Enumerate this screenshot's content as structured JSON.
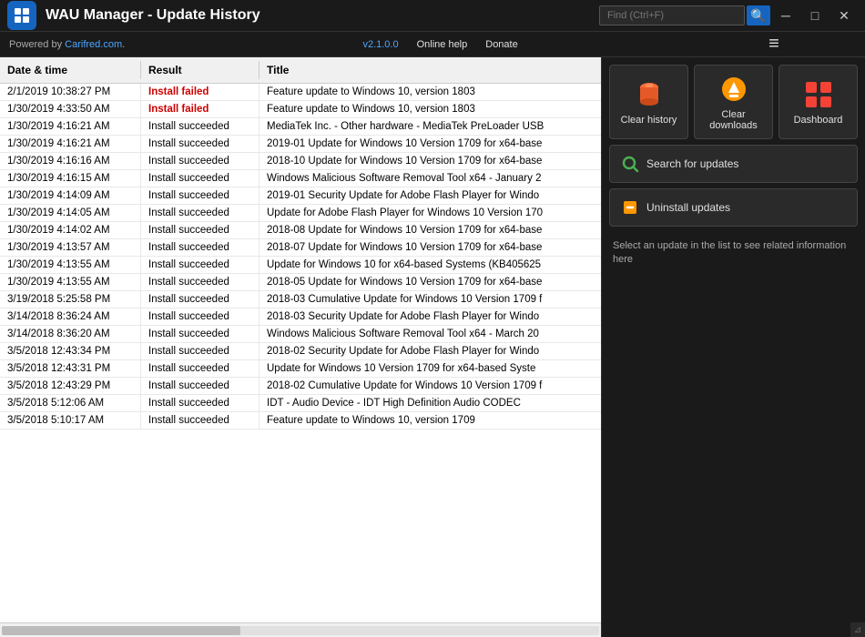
{
  "window": {
    "title": "WAU Manager - Update History",
    "powered_by_prefix": "Powered by ",
    "powered_by_link": "Carifred.com",
    "powered_by_suffix": ".",
    "version": "v2.1.0.0",
    "online_help": "Online help",
    "donate": "Donate",
    "search_placeholder": "Find (Ctrl+F)"
  },
  "table": {
    "columns": [
      "Date & time",
      "Result",
      "Title"
    ],
    "rows": [
      {
        "date": "2/1/2019 10:38:27 PM",
        "result": "Install failed",
        "title": "Feature update to Windows 10, version 1803",
        "failed": true
      },
      {
        "date": "1/30/2019 4:33:50 AM",
        "result": "Install failed",
        "title": "Feature update to Windows 10, version 1803",
        "failed": true
      },
      {
        "date": "1/30/2019 4:16:21 AM",
        "result": "Install succeeded",
        "title": "MediaTek Inc. - Other hardware - MediaTek PreLoader USB",
        "failed": false
      },
      {
        "date": "1/30/2019 4:16:21 AM",
        "result": "Install succeeded",
        "title": "2019-01 Update for Windows 10 Version 1709 for x64-base",
        "failed": false
      },
      {
        "date": "1/30/2019 4:16:16 AM",
        "result": "Install succeeded",
        "title": "2018-10 Update for Windows 10 Version 1709 for x64-base",
        "failed": false
      },
      {
        "date": "1/30/2019 4:16:15 AM",
        "result": "Install succeeded",
        "title": "Windows Malicious Software Removal Tool x64 - January 2",
        "failed": false
      },
      {
        "date": "1/30/2019 4:14:09 AM",
        "result": "Install succeeded",
        "title": "2019-01 Security Update for Adobe Flash Player for Windo",
        "failed": false
      },
      {
        "date": "1/30/2019 4:14:05 AM",
        "result": "Install succeeded",
        "title": "Update for Adobe Flash Player for Windows 10 Version 170",
        "failed": false
      },
      {
        "date": "1/30/2019 4:14:02 AM",
        "result": "Install succeeded",
        "title": "2018-08 Update for Windows 10 Version 1709 for x64-base",
        "failed": false
      },
      {
        "date": "1/30/2019 4:13:57 AM",
        "result": "Install succeeded",
        "title": "2018-07 Update for Windows 10 Version 1709 for x64-base",
        "failed": false
      },
      {
        "date": "1/30/2019 4:13:55 AM",
        "result": "Install succeeded",
        "title": "Update for Windows 10 for x64-based Systems (KB405625",
        "failed": false
      },
      {
        "date": "1/30/2019 4:13:55 AM",
        "result": "Install succeeded",
        "title": "2018-05 Update for Windows 10 Version 1709 for x64-base",
        "failed": false
      },
      {
        "date": "3/19/2018 5:25:58 PM",
        "result": "Install succeeded",
        "title": "2018-03 Cumulative Update for Windows 10 Version 1709 f",
        "failed": false
      },
      {
        "date": "3/14/2018 8:36:24 AM",
        "result": "Install succeeded",
        "title": "2018-03 Security Update for Adobe Flash Player for Windo",
        "failed": false
      },
      {
        "date": "3/14/2018 8:36:20 AM",
        "result": "Install succeeded",
        "title": "Windows Malicious Software Removal Tool x64 - March 20",
        "failed": false
      },
      {
        "date": "3/5/2018 12:43:34 PM",
        "result": "Install succeeded",
        "title": "2018-02 Security Update for Adobe Flash Player for Windo",
        "failed": false
      },
      {
        "date": "3/5/2018 12:43:31 PM",
        "result": "Install succeeded",
        "title": "Update for Windows 10 Version 1709 for x64-based Syste",
        "failed": false
      },
      {
        "date": "3/5/2018 12:43:29 PM",
        "result": "Install succeeded",
        "title": "2018-02 Cumulative Update for Windows 10 Version 1709 f",
        "failed": false
      },
      {
        "date": "3/5/2018 5:12:06 AM",
        "result": "Install succeeded",
        "title": "IDT - Audio Device - IDT High Definition Audio CODEC",
        "failed": false
      },
      {
        "date": "3/5/2018 5:10:17 AM",
        "result": "Install succeeded",
        "title": "Feature update to Windows 10, version 1709",
        "failed": false
      }
    ]
  },
  "sidebar": {
    "clear_history_label": "Clear history",
    "clear_downloads_label": "Clear downloads",
    "dashboard_label": "Dashboard",
    "search_updates_label": "Search for updates",
    "uninstall_updates_label": "Uninstall updates",
    "info_text": "Select an update in the list to see related information here"
  }
}
